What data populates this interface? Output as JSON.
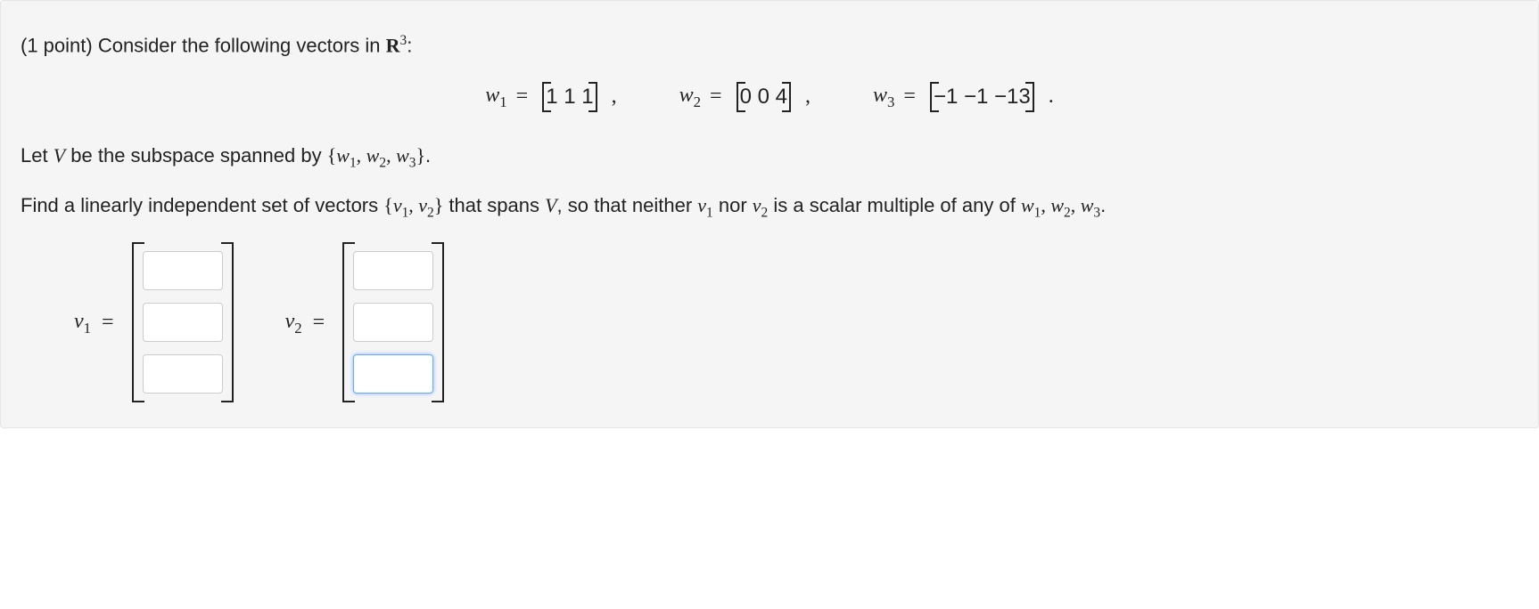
{
  "problem": {
    "points_prefix": "(1 point) ",
    "intro": "Consider the following vectors in ",
    "space_symbol": "R",
    "space_exp": "3",
    "colon": ":",
    "w_symbol": "w",
    "equals": " = ",
    "w1_sub": "1",
    "w2_sub": "2",
    "w3_sub": "3",
    "w1": [
      "1",
      "1",
      "1"
    ],
    "w2": [
      "0",
      "0",
      "4"
    ],
    "w3": [
      "−1",
      "−1",
      "−13"
    ],
    "comma": ",",
    "period": ".",
    "para2_a": "Let ",
    "V_sym": "V",
    "para2_b": " be the subspace spanned by ",
    "set_open": "{",
    "set_close": "}",
    "set_sep": ", ",
    "para3_a": "Find a linearly independent set of vectors ",
    "v_symbol": "v",
    "para3_b": " that spans ",
    "para3_c": ", so that neither ",
    "para3_d": " nor ",
    "para3_e": " is a scalar multiple of any of ",
    "v1_sub": "1",
    "v2_sub": "2"
  },
  "answers": {
    "v1": [
      "",
      "",
      ""
    ],
    "v2": [
      "",
      "",
      ""
    ]
  },
  "chart_data": {
    "type": "table",
    "title": "Given vectors in R^3",
    "series": [
      {
        "name": "w1",
        "values": [
          1,
          1,
          1
        ]
      },
      {
        "name": "w2",
        "values": [
          0,
          0,
          4
        ]
      },
      {
        "name": "w3",
        "values": [
          -1,
          -1,
          -13
        ]
      }
    ]
  }
}
